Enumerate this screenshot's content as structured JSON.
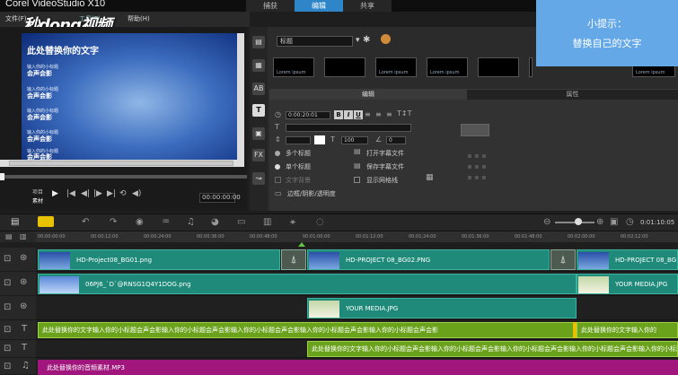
{
  "app": {
    "title": "Corel VideoStudio X10",
    "logo": "秒dong视频"
  },
  "steps": [
    {
      "label": "捕获"
    },
    {
      "label": "编辑"
    },
    {
      "label": "共享"
    }
  ],
  "menu": [
    {
      "label": "文件(F)"
    },
    {
      "label": "工具(T)"
    },
    {
      "label": "帮助(H)"
    }
  ],
  "preview": {
    "title": "此处替换你的文字",
    "lines": [
      {
        "small": "输入你的小标题",
        "big": "会声会影"
      },
      {
        "small": "输入你的小标题",
        "big": "会声会影"
      },
      {
        "small": "输入你的小标题",
        "big": "会声会影"
      },
      {
        "small": "输入你的小标题",
        "big": "会声会影"
      },
      {
        "small": "输入你的小标题",
        "big": "会声会影"
      }
    ],
    "mode_project": "项目",
    "mode_clip": "素材",
    "timecode": "00:00:00:00"
  },
  "library": {
    "category": "标题",
    "thumbs": [
      {
        "caption": "Lorem ipsum"
      },
      {
        "caption": ""
      },
      {
        "caption": "Lorem ipsum"
      },
      {
        "caption": "Lorem ipsum"
      },
      {
        "caption": ""
      },
      {
        "caption": ""
      },
      {
        "caption": "Lorem ipsum"
      }
    ]
  },
  "tip": {
    "title": "小提示：",
    "body": "替换自己的文字"
  },
  "options": {
    "tab_edit": "编辑",
    "tab_attr": "属性",
    "duration": "0:00:20:01",
    "bold": "B",
    "italic": "I",
    "underline": "U",
    "font_size": "100",
    "rotation": "0",
    "multi_title": "多个标题",
    "single_title": "单个标题",
    "text_bg": "文字背景",
    "open_file": "打开字幕文件",
    "save_file": "保存字幕文件",
    "show_grid": "显示网格线",
    "border_shadow": "边框/阴影/透明度"
  },
  "timeline": {
    "timecode": "0:01:10:05",
    "ruler": [
      "00:00:00:00",
      "00:00:12:00",
      "00:00:24:00",
      "00:00:36:00",
      "00:00:48:00",
      "00:01:00:00",
      "00:01:12:00",
      "00:01:24:00",
      "00:01:36:00",
      "00:01:48:00",
      "00:02:00:00",
      "00:02:12:00"
    ],
    "video": [
      "HD-Project08_BG01.png",
      "HD-PROJECT 08_BG02.PNG",
      "HD-PROJECT 08_BG"
    ],
    "overlay1": [
      "06PJ6_`D`@RNSG1Q4Y1DOG.png",
      "YOUR MEDIA.JPG"
    ],
    "overlay2": [
      "YOUR MEDIA.JPG"
    ],
    "title1": [
      "此处替换你的文字输入你的小标题会声会影输入你的小标题会声会影输入你的小标题会声会影输入你的小标题会声会影输入你的小标题会声会影",
      "此处替换你的文字输入你的"
    ],
    "title2": [
      "此处替换你的文字输入你的小标题会声会影输入你的小标题会声会影输入你的小标题会声会影输入你的小标题会声会影输入你的小标题会声会影"
    ],
    "audio": [
      "此处替换你的音频素材.MP3"
    ]
  }
}
